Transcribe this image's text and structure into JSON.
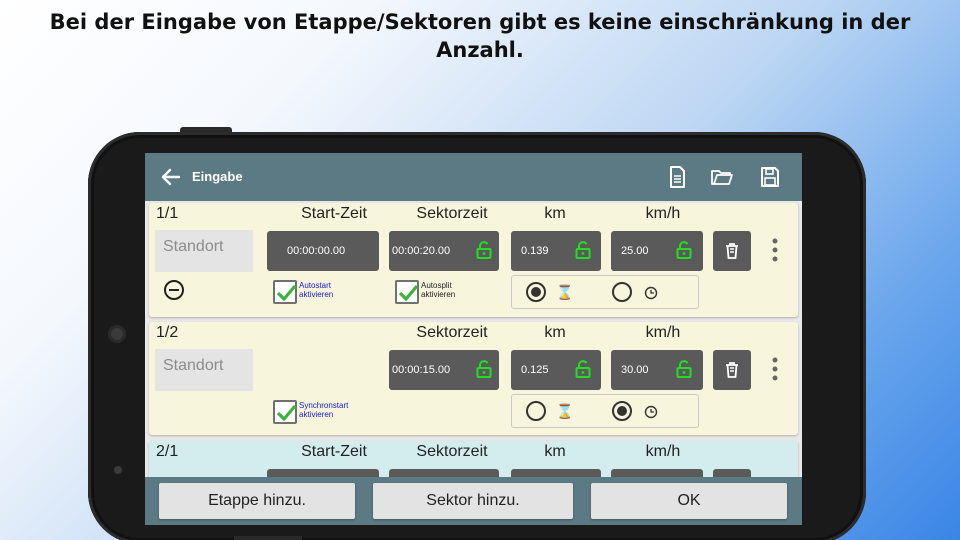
{
  "headline": {
    "line1": "Bei der Eingabe von Etappe/Sektoren gibt es keine einschränkung in der",
    "line2": "Anzahl."
  },
  "appbar": {
    "title": "Eingabe",
    "icons": [
      "back-arrow-icon",
      "document-icon",
      "folder-open-icon",
      "save-icon"
    ]
  },
  "columns": {
    "start": "Start-Zeit",
    "sektor": "Sektorzeit",
    "km": "km",
    "kmh": "km/h"
  },
  "rows": [
    {
      "id": "1/1",
      "standort": "Standort",
      "start_time": "00:00:00.00",
      "sektorzeit": "00:00:20.00",
      "km": "0.139",
      "kmh": "25.00",
      "checkbox1_label": [
        "Autostart",
        "aktivieren"
      ],
      "checkbox2_label": [
        "Autosplit",
        "aktivieren"
      ],
      "mode": "hourglass"
    },
    {
      "id": "1/2",
      "standort": "Standort",
      "sektorzeit": "00:00:15.00",
      "km": "0.125",
      "kmh": "30.00",
      "checkbox1_label": [
        "Synchronstart",
        "aktivieren"
      ],
      "mode": "clock"
    },
    {
      "id": "2/1"
    }
  ],
  "bottom": {
    "etappe": "Etappe hinzu.",
    "sektor": "Sektor hinzu.",
    "ok": "OK"
  },
  "colors": {
    "appbar": "#5b7a84",
    "card_yellow": "#f7f5dc",
    "card_blue": "#d3ecee",
    "field": "#5a5a5a",
    "lock_green": "#22dd22",
    "check_green": "#3cb43c",
    "check_label_blue": "#1a1ae0"
  }
}
